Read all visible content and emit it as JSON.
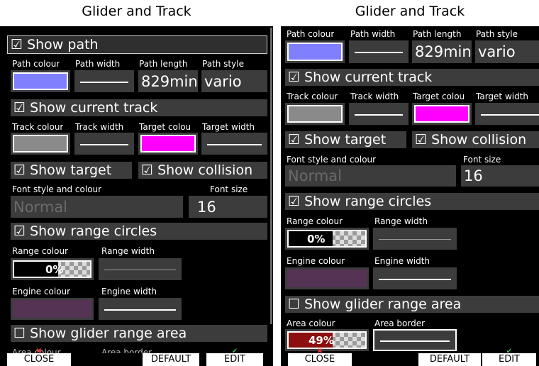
{
  "title": "Glider and Track",
  "colors": {
    "path": "#8080ff",
    "track": "#8a8a8a",
    "target": "#ff00ff",
    "engine": "#553355",
    "area": "#8c0f0f",
    "section_bg": "#3c3c3c",
    "panel_bg": "#000000"
  },
  "left": {
    "show_path": "☑ Show path",
    "path_labels": [
      "Path colour",
      "Path width",
      "Path length",
      "Path style"
    ],
    "path_length": "829min",
    "path_style": "vario",
    "show_current_track": "☑ Show current track",
    "track_labels": [
      "Track colour",
      "Track width",
      "Target colou",
      "Target width"
    ],
    "show_target": "☑ Show target",
    "show_collision": "☑ Show collision",
    "font_style_label": "Font style and colour",
    "font_size_label": "Font size",
    "font_style_value": "Normal",
    "font_size_value": "16",
    "show_range_circles": "☑ Show range circles",
    "range_colour_label": "Range colour",
    "range_width_label": "Range width",
    "range_percent": "0%",
    "engine_colour_label": "Engine colour",
    "engine_width_label": "Engine width",
    "show_glider_range": "☐ Show glider range area",
    "area_colour_label": "Area colour",
    "area_border_label": "Area border"
  },
  "right": {
    "path_labels": [
      "Path colour",
      "Path width",
      "Path length",
      "Path style"
    ],
    "path_length": "829min",
    "path_style": "vario",
    "show_current_track": "☑ Show current track",
    "track_labels": [
      "Track colour",
      "Track width",
      "Target colou",
      "Target width"
    ],
    "show_target": "☑ Show target",
    "show_collision": "☑ Show collision",
    "font_style_label": "Font style and colour",
    "font_size_label": "Font size",
    "font_style_value": "Normal",
    "font_size_value": "16",
    "show_range_circles": "☑ Show range circles",
    "range_colour_label": "Range colour",
    "range_width_label": "Range width",
    "range_percent": "0%",
    "engine_colour_label": "Engine colour",
    "engine_width_label": "Engine width",
    "show_glider_range": "☐ Show glider range area",
    "area_colour_label": "Area colour",
    "area_border_label": "Area border",
    "area_percent": "49%"
  },
  "buttons": {
    "close": "CLOSE",
    "default": "DEFAULT",
    "edit": "EDIT",
    "close_icon": "x-icon",
    "edit_icon": "check-icon"
  }
}
